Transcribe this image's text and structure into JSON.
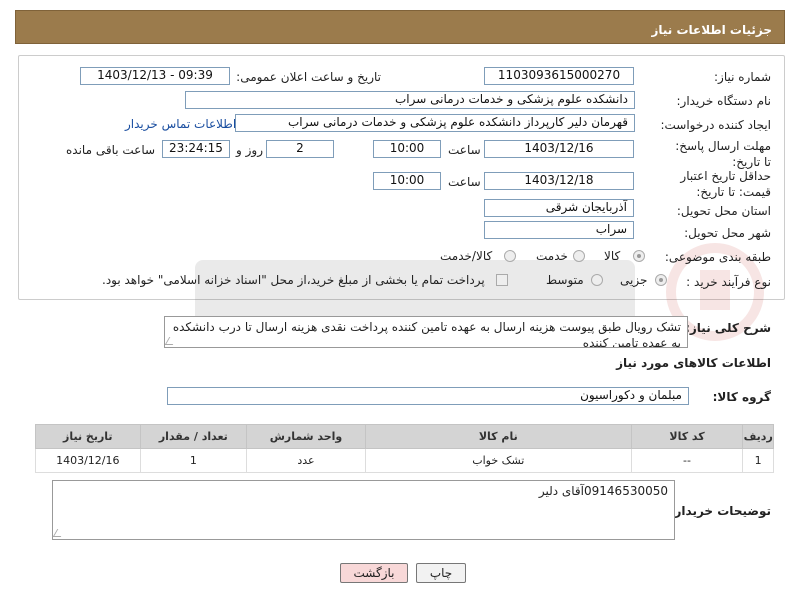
{
  "header": {
    "title": "جزئیات اطلاعات نیاز"
  },
  "fields": {
    "need_number": {
      "label": "شماره نیاز:",
      "value": "1103093615000270"
    },
    "announce_date": {
      "label": "تاریخ و ساعت اعلان عمومی:",
      "value": "1403/12/13 - 09:39"
    },
    "buyer_org": {
      "label": "نام دستگاه خریدار:",
      "value": "دانشکده علوم پزشکی و خدمات درمانی سراب"
    },
    "requester": {
      "label": "ایجاد کننده درخواست:",
      "value": "قهرمان دلیر کارپرداز دانشکده علوم پزشکی و خدمات درمانی سراب",
      "contact_link": "اطلاعات تماس خریدار"
    },
    "reply_deadline": {
      "label": "مهلت ارسال پاسخ: تا تاریخ:",
      "date": "1403/12/16",
      "time_label": "ساعت",
      "time": "10:00",
      "days": "2",
      "days_label": "روز و",
      "remaining": "23:24:15",
      "remaining_label": "ساعت باقی مانده"
    },
    "price_validity": {
      "label": "حداقل تاریخ اعتبار قیمت: تا تاریخ:",
      "date": "1403/12/18",
      "time_label": "ساعت",
      "time": "10:00"
    },
    "province": {
      "label": "استان محل تحویل:",
      "value": "آذربایجان شرقی"
    },
    "city": {
      "label": "شهر محل تحویل:",
      "value": "سراب"
    },
    "category": {
      "label": "طبقه بندی موضوعی:",
      "options": [
        "کالا",
        "خدمت",
        "کالا/خدمت"
      ],
      "selected": "کالا"
    },
    "purchase_type": {
      "label": "نوع فرآیند خرید :",
      "options": [
        "جزیی",
        "متوسط"
      ],
      "selected": "جزیی",
      "payment_note": "پرداخت تمام یا بخشی از مبلغ خرید،از محل \"اسناد خزانه اسلامی\" خواهد بود."
    }
  },
  "description": {
    "label": "شرح کلی نیاز:",
    "value": "تشک رویال طبق پیوست هزینه ارسال به عهده تامین کننده پرداخت نقدی هزینه ارسال تا درب دانشکده به عهده تامین کننده"
  },
  "items_section": {
    "title": "اطلاعات کالاهای مورد نیاز",
    "group_label": "گروه کالا:",
    "group_value": "مبلمان و دکوراسیون",
    "columns": [
      "ردیف",
      "کد کالا",
      "نام کالا",
      "واحد شمارش",
      "تعداد / مقدار",
      "تاریخ نیاز"
    ],
    "rows": [
      {
        "row": "1",
        "code": "--",
        "name": "تشک خواب",
        "unit": "عدد",
        "qty": "1",
        "date": "1403/12/16"
      }
    ]
  },
  "buyer_notes": {
    "label": "توضیحات خریدار:",
    "value": "09146530050آقای دلیر"
  },
  "buttons": {
    "print": "چاپ",
    "back": "بازگشت"
  },
  "colors": {
    "header_bg": "#9b7b4c",
    "back_button_bg": "#f8d8d8",
    "link": "#1a4ea0"
  }
}
